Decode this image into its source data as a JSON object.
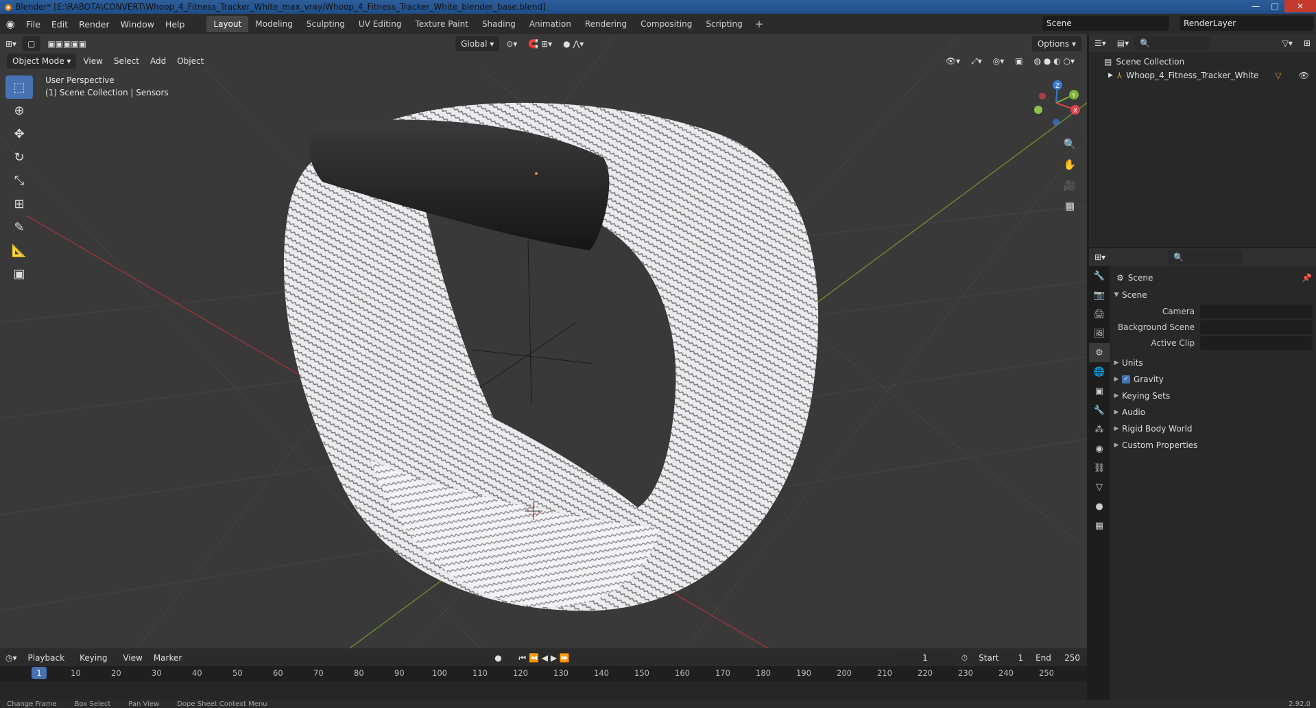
{
  "window": {
    "title": "Blender* [E:\\RABOTA\\CONVERT\\Whoop_4_Fitness_Tracker_White_max_vray/Whoop_4_Fitness_Tracker_White_blender_base.blend]",
    "minimize": "—",
    "maximize": "□",
    "close": "✕"
  },
  "menu": {
    "items": [
      "File",
      "Edit",
      "Render",
      "Window",
      "Help"
    ],
    "workspaces": [
      "Layout",
      "Modeling",
      "Sculpting",
      "UV Editing",
      "Texture Paint",
      "Shading",
      "Animation",
      "Rendering",
      "Compositing",
      "Scripting"
    ],
    "active_workspace": "Layout",
    "add": "+",
    "scene": "Scene",
    "render_layer": "RenderLayer"
  },
  "viewport": {
    "mode": "Object Mode",
    "menus": [
      "View",
      "Select",
      "Add",
      "Object"
    ],
    "orientation": "Global",
    "options": "Options",
    "perspective": "User Perspective",
    "collection": "(1) Scene Collection | Sensors",
    "gizmo": {
      "z": "Z",
      "y": "Y",
      "x": "X"
    }
  },
  "timeline": {
    "menus": [
      "Playback",
      "Keying",
      "View",
      "Marker"
    ],
    "current_frame": "1",
    "start_label": "Start",
    "start": "1",
    "end_label": "End",
    "end": "250",
    "ticks": [
      "10",
      "20",
      "30",
      "40",
      "50",
      "60",
      "70",
      "80",
      "90",
      "100",
      "110",
      "120",
      "130",
      "140",
      "150",
      "160",
      "170",
      "180",
      "190",
      "200",
      "210",
      "220",
      "230",
      "240",
      "250"
    ],
    "cursor_frame": "1"
  },
  "status": {
    "items": [
      "Change Frame",
      "Box Select",
      "Pan View",
      "Dope Sheet Context Menu"
    ],
    "version": "2.92.0"
  },
  "outliner": {
    "root": "Scene Collection",
    "object": "Whoop_4_Fitness_Tracker_White"
  },
  "properties": {
    "context": "Scene",
    "section": "Scene",
    "camera_label": "Camera",
    "bg_label": "Background Scene",
    "clip_label": "Active Clip",
    "panels": [
      "Units",
      "Gravity",
      "Keying Sets",
      "Audio",
      "Rigid Body World",
      "Custom Properties"
    ]
  }
}
